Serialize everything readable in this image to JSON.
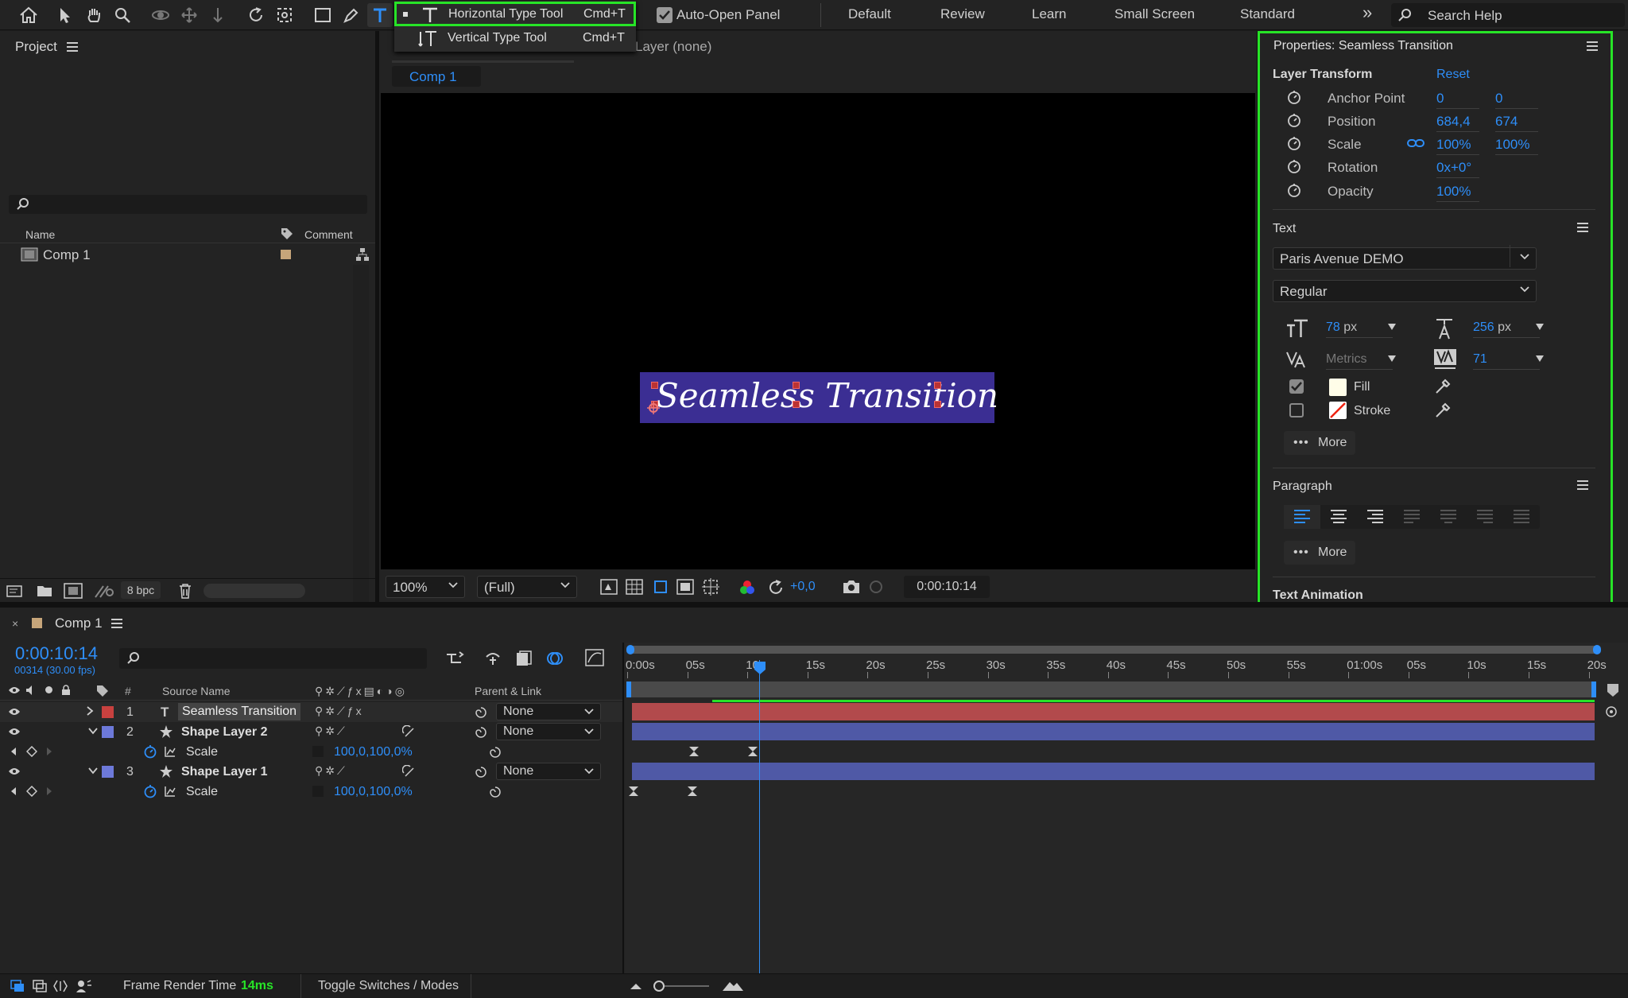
{
  "toolbar": {
    "auto_open_panel": "Auto-Open Panel",
    "workspaces": [
      "Default",
      "Review",
      "Learn",
      "Small Screen",
      "Standard"
    ],
    "overflow": "»",
    "search_placeholder": "Search Help"
  },
  "type_menu": {
    "items": [
      {
        "label": "Horizontal Type Tool",
        "shortcut": "Cmd+T"
      },
      {
        "label": "Vertical Type Tool",
        "shortcut": "Cmd+T"
      }
    ]
  },
  "project": {
    "title": "Project",
    "col_name": "Name",
    "col_comment": "Comment",
    "item": "Comp 1",
    "bpc": "8 bpc"
  },
  "comp_viewer": {
    "layer_label": "Layer (none)",
    "tab": "Comp 1",
    "text": "Seamless Transition",
    "zoom": "100%",
    "resolution": "(Full)",
    "exposure": "+0,0",
    "timecode": "0:00:10:14"
  },
  "properties": {
    "title": "Properties: Seamless Transition",
    "layer_transform": "Layer Transform",
    "reset": "Reset",
    "rows": [
      {
        "label": "Anchor Point",
        "v1": "0",
        "v2": "0"
      },
      {
        "label": "Position",
        "v1": "684,4",
        "v2": "674"
      },
      {
        "label": "Scale",
        "v1": "100%",
        "v2": "100%"
      },
      {
        "label": "Rotation",
        "v1": "0x+0°",
        "v2": ""
      },
      {
        "label": "Opacity",
        "v1": "100%",
        "v2": ""
      }
    ],
    "text_section": "Text",
    "font": "Paris Avenue DEMO",
    "style": "Regular",
    "font_size": "78",
    "font_size_unit": "px",
    "leading": "256",
    "leading_unit": "px",
    "kerning": "Metrics",
    "tracking": "71",
    "fill": "Fill",
    "stroke": "Stroke",
    "more": "More",
    "paragraph": "Paragraph",
    "text_animation": "Text Animation"
  },
  "timeline": {
    "tab": "Comp 1",
    "timecode": "0:00:10:14",
    "frames": "00314 (30.00 fps)",
    "col_num": "#",
    "col_source": "Source Name",
    "col_parent": "Parent & Link",
    "ruler": [
      "0:00s",
      "05s",
      "10s",
      "15s",
      "20s",
      "25s",
      "30s",
      "35s",
      "40s",
      "45s",
      "50s",
      "55s",
      "01:00s",
      "05s",
      "10s",
      "15s",
      "20s"
    ],
    "layers": [
      {
        "num": "1",
        "name": "Seamless Transition",
        "parent": "None",
        "color": "#c8413f"
      },
      {
        "num": "2",
        "name": "Shape Layer 2",
        "parent": "None",
        "color": "#6d79d9"
      },
      {
        "num": "3",
        "name": "Shape Layer 1",
        "parent": "None",
        "color": "#6d79d9"
      }
    ],
    "prop_label": "Scale",
    "prop_value": "100,0,100,0%",
    "footer_render_label": "Frame Render Time",
    "footer_render_value": "14ms",
    "footer_toggle": "Toggle Switches / Modes"
  },
  "colors": {
    "highlight": "#27e427",
    "accent": "#2e8ef8",
    "text_bg": "#3b2e93",
    "layer_text": "#b24a4c",
    "layer_shape": "#4f59a6"
  }
}
